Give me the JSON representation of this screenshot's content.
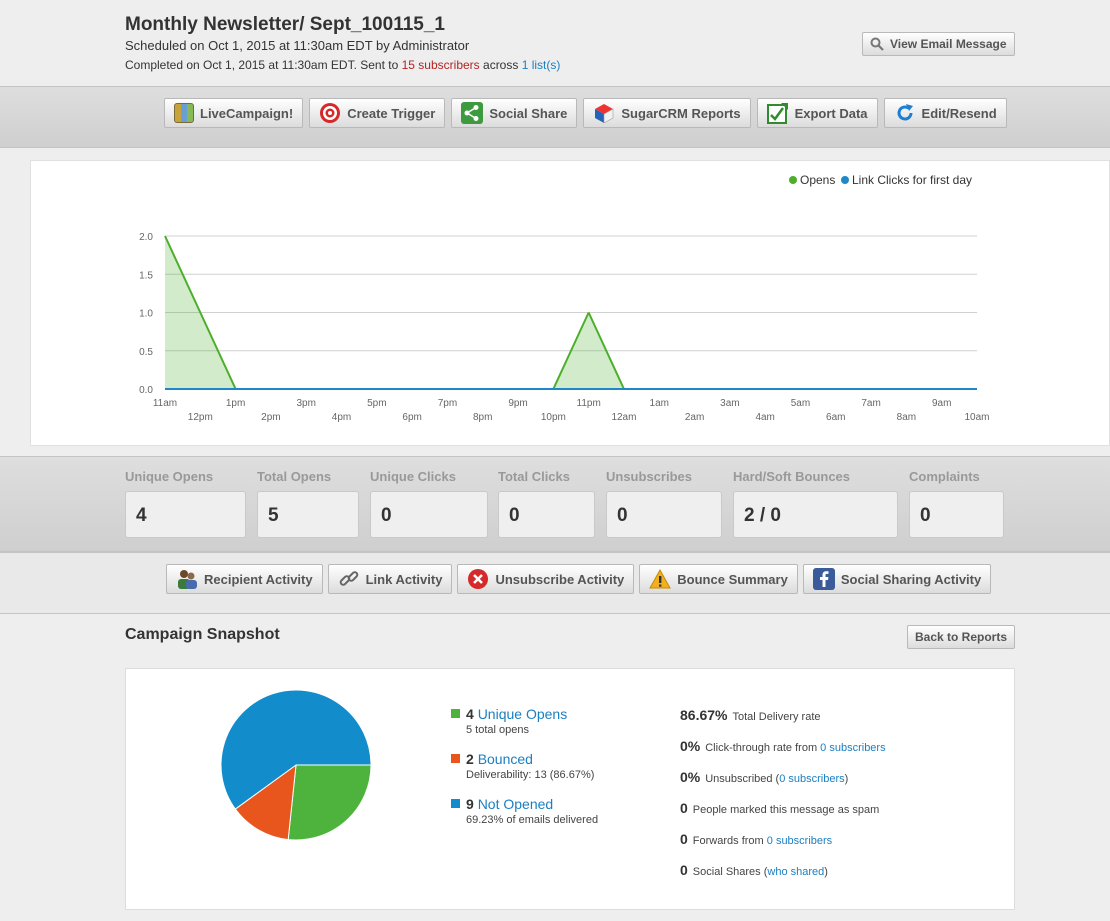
{
  "header": {
    "title": "Monthly Newsletter/ Sept_100115_1",
    "scheduled": "Scheduled on Oct 1, 2015 at 11:30am EDT by Administrator",
    "completed_prefix": "Completed on Oct 1, 2015 at 11:30am EDT. Sent to",
    "subscribers_link": "15 subscribers",
    "across": "across",
    "lists_link": "1 list(s)",
    "view_email_label": "View Email Message"
  },
  "toolbar": [
    {
      "label": "LiveCampaign!",
      "icon": "map-icon"
    },
    {
      "label": "Create Trigger",
      "icon": "target-icon"
    },
    {
      "label": "Social Share",
      "icon": "share-icon"
    },
    {
      "label": "SugarCRM Reports",
      "icon": "cube-icon"
    },
    {
      "label": "Export Data",
      "icon": "export-icon"
    },
    {
      "label": "Edit/Resend",
      "icon": "refresh-icon"
    }
  ],
  "chart_data": {
    "type": "area",
    "legend": [
      "Opens",
      "Link Clicks for first day"
    ],
    "legend_position": "top-right",
    "colors": {
      "opens": "#4caf2a",
      "clicks": "#1e88c8"
    },
    "ylim": [
      0,
      2.0
    ],
    "yticks": [
      "0.0",
      "0.5",
      "1.0",
      "1.5",
      "2.0"
    ],
    "x_labels_upper": [
      "11am",
      "1pm",
      "3pm",
      "5pm",
      "7pm",
      "9pm",
      "11pm",
      "1am",
      "3am",
      "5am",
      "7am",
      "9am"
    ],
    "x_labels_lower": [
      "12pm",
      "2pm",
      "4pm",
      "6pm",
      "8pm",
      "10pm",
      "12am",
      "2am",
      "4am",
      "6am",
      "8am",
      "10am"
    ],
    "x": [
      "11am",
      "12pm",
      "1pm",
      "2pm",
      "3pm",
      "4pm",
      "5pm",
      "6pm",
      "7pm",
      "8pm",
      "9pm",
      "10pm",
      "11pm",
      "12am",
      "1am",
      "2am",
      "3am",
      "4am",
      "5am",
      "6am",
      "7am",
      "8am",
      "9am",
      "10am"
    ],
    "series": [
      {
        "name": "Opens",
        "values": [
          2,
          1,
          0,
          0,
          0,
          0,
          0,
          0,
          0,
          0,
          0,
          0,
          1,
          0,
          0,
          0,
          0,
          0,
          0,
          0,
          0,
          0,
          0,
          0
        ]
      },
      {
        "name": "Link Clicks for first day",
        "values": [
          0,
          0,
          0,
          0,
          0,
          0,
          0,
          0,
          0,
          0,
          0,
          0,
          0,
          0,
          0,
          0,
          0,
          0,
          0,
          0,
          0,
          0,
          0,
          0
        ]
      }
    ],
    "grid": true
  },
  "stats": [
    {
      "label": "Unique Opens",
      "value": "4"
    },
    {
      "label": "Total Opens",
      "value": "5"
    },
    {
      "label": "Unique Clicks",
      "value": "0"
    },
    {
      "label": "Total Clicks",
      "value": "0"
    },
    {
      "label": "Unsubscribes",
      "value": "0"
    },
    {
      "label": "Hard/Soft Bounces",
      "value": "2 / 0"
    },
    {
      "label": "Complaints",
      "value": "0"
    }
  ],
  "activity_toolbar": [
    {
      "label": "Recipient Activity",
      "icon": "people-icon"
    },
    {
      "label": "Link Activity",
      "icon": "link-icon"
    },
    {
      "label": "Unsubscribe Activity",
      "icon": "cancel-icon"
    },
    {
      "label": "Bounce Summary",
      "icon": "warning-icon"
    },
    {
      "label": "Social Sharing Activity",
      "icon": "facebook-icon"
    }
  ],
  "snapshot": {
    "title": "Campaign Snapshot",
    "back_label": "Back to Reports",
    "pie": [
      {
        "name": "Unique Opens",
        "value": 4,
        "color": "#4db33d"
      },
      {
        "name": "Bounced",
        "value": 2,
        "color": "#e8561e"
      },
      {
        "name": "Not Opened",
        "value": 9,
        "color": "#128ccb"
      }
    ],
    "legend": [
      {
        "count": "4",
        "label": "Unique Opens",
        "sub": "5 total opens",
        "color": "#4db33d"
      },
      {
        "count": "2",
        "label": "Bounced",
        "sub": "Deliverability: 13 (86.67%)",
        "color": "#e8561e"
      },
      {
        "count": "9",
        "label": "Not Opened",
        "sub": "69.23% of emails delivered",
        "color": "#128ccb"
      }
    ],
    "metrics": {
      "delivery_val": "86.67%",
      "delivery_text": "Total Delivery rate",
      "ctr_val": "0%",
      "ctr_text": "Click-through rate from",
      "ctr_link": "0 subscribers",
      "unsub_val": "0%",
      "unsub_text": "Unsubscribed (",
      "unsub_link": "0 subscribers",
      "unsub_close": ")",
      "spam_val": "0",
      "spam_text": "People marked this message as spam",
      "fwd_val": "0",
      "fwd_text": "Forwards from",
      "fwd_link": "0 subscribers",
      "social_val": "0",
      "social_text": "Social Shares (",
      "social_link": "who shared",
      "social_close": ")"
    }
  }
}
